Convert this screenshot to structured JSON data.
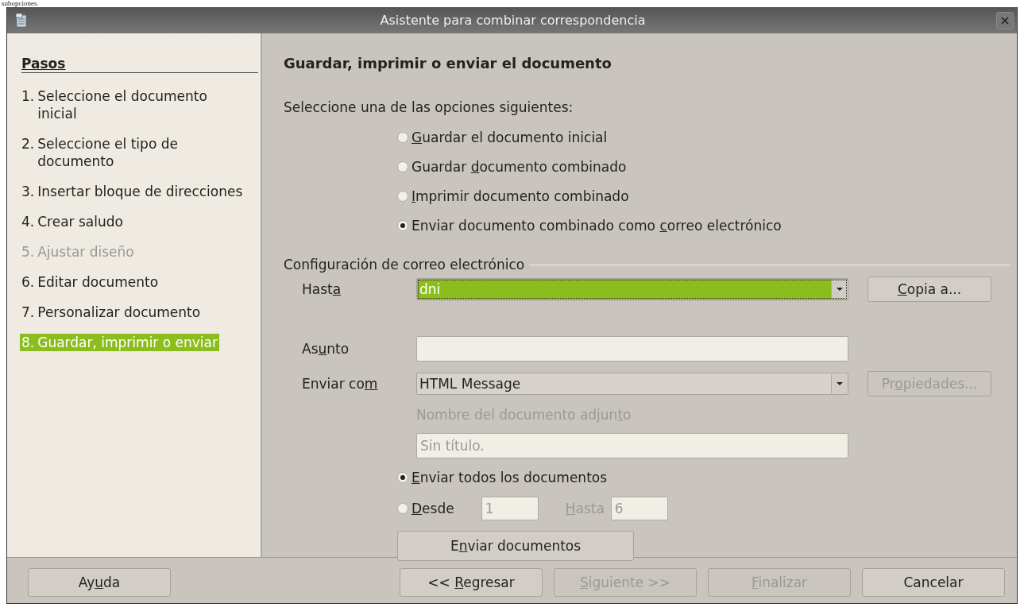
{
  "page_text": "subopciones.",
  "window": {
    "title": "Asistente para combinar correspondencia"
  },
  "sidebar": {
    "title": "Pasos",
    "items": [
      {
        "number": "1.",
        "label": "Seleccione el documento inicial",
        "selected": false,
        "disabled": false
      },
      {
        "number": "2.",
        "label": "Seleccione el tipo de documento",
        "selected": false,
        "disabled": false
      },
      {
        "number": "3.",
        "label": "Insertar bloque de direcciones",
        "selected": false,
        "disabled": false
      },
      {
        "number": "4.",
        "label": "Crear saludo",
        "selected": false,
        "disabled": false
      },
      {
        "number": "5.",
        "label": "Ajustar diseño",
        "selected": false,
        "disabled": true
      },
      {
        "number": "6.",
        "label": "Editar documento",
        "selected": false,
        "disabled": false
      },
      {
        "number": "7.",
        "label": "Personalizar documento",
        "selected": false,
        "disabled": false
      },
      {
        "number": "8.",
        "label": "Guardar, imprimir o enviar",
        "selected": true,
        "disabled": false
      }
    ]
  },
  "main": {
    "heading": "Guardar, imprimir o enviar el documento",
    "prompt": "Seleccione una de las opciones siguientes:",
    "options": [
      {
        "label": {
          "key": "G",
          "post": "uardar el documento inicial"
        },
        "selected": false
      },
      {
        "label": {
          "pre": "Guardar ",
          "key": "d",
          "post": "ocumento combinado"
        },
        "selected": false
      },
      {
        "label": {
          "key": "I",
          "post": "mprimir documento combinado"
        },
        "selected": false
      },
      {
        "label": {
          "pre": "Enviar documento combinado como ",
          "key": "c",
          "post": "orreo electrónico"
        },
        "selected": true
      }
    ],
    "email": {
      "legend": "Configuración de correo electrónico",
      "to": {
        "label": {
          "pre": "Hast",
          "key": "a"
        },
        "value": "dni",
        "highlighted": true,
        "button": {
          "label": {
            "key": "C",
            "post": "opia a..."
          },
          "disabled": false
        }
      },
      "subject": {
        "label": {
          "pre": "As",
          "key": "u",
          "post": "nto"
        }
      },
      "send_as": {
        "label": {
          "pre": "Enviar co",
          "key": "m"
        },
        "value": "HTML Message",
        "button": {
          "label": {
            "pre": "Pr",
            "key": "o",
            "post": "piedades..."
          },
          "disabled": true
        }
      },
      "attachment": {
        "label": {
          "pre": "Nombre del documento adjun",
          "key": "t",
          "post": "o"
        },
        "value": "Sin título.",
        "disabled": true
      },
      "send_all": {
        "label": {
          "key": "E",
          "post": "nviar todos los documentos"
        },
        "selected": true
      },
      "range": {
        "label": {
          "key": "D",
          "post": "esde"
        },
        "selected": false,
        "from": "1",
        "to_label": {
          "key": "H",
          "post": "asta"
        },
        "to": "6",
        "disabled": true
      },
      "send_button": {
        "label": {
          "pre": "E",
          "key": "n",
          "post": "viar documentos"
        },
        "disabled": false
      }
    }
  },
  "buttons": [
    {
      "label": {
        "pre": "Ay",
        "key": "u",
        "post": "da"
      },
      "disabled": false,
      "kind": "help"
    },
    {
      "label": {
        "pre": "<< ",
        "key": "R",
        "post": "egresar"
      },
      "disabled": false,
      "kind": "nav"
    },
    {
      "label": {
        "key": "S",
        "post": "iguiente >>"
      },
      "disabled": true,
      "kind": "nav"
    },
    {
      "label": {
        "key": "F",
        "post": "inalizar"
      },
      "disabled": true,
      "kind": "nav"
    },
    {
      "label": {
        "pre": "Cancelar"
      },
      "disabled": false,
      "kind": "nav"
    }
  ]
}
